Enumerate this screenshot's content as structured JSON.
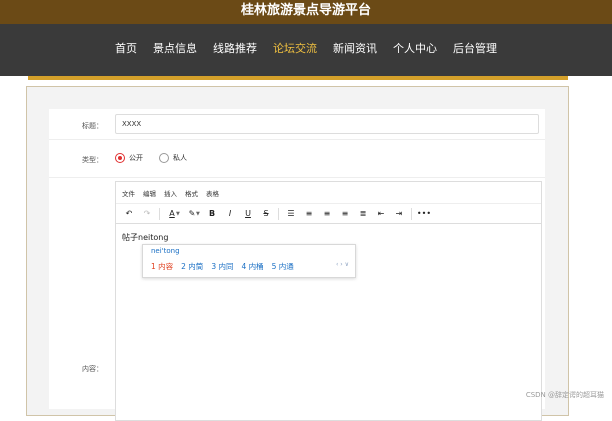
{
  "site": {
    "title": "桂林旅游景点导游平台"
  },
  "nav": {
    "items": [
      {
        "label": "首页"
      },
      {
        "label": "景点信息"
      },
      {
        "label": "线路推荐"
      },
      {
        "label": "论坛交流"
      },
      {
        "label": "新闻资讯"
      },
      {
        "label": "个人中心"
      },
      {
        "label": "后台管理"
      }
    ],
    "active_index": 3
  },
  "form": {
    "title_label": "标题：",
    "title_value": "XXXX",
    "type_label": "类型：",
    "type_options": [
      {
        "label": "公开",
        "checked": true
      },
      {
        "label": "私人",
        "checked": false
      }
    ],
    "content_label": "内容："
  },
  "editor": {
    "menus": [
      "文件",
      "编辑",
      "插入",
      "格式",
      "表格"
    ],
    "toolbar_icons": [
      "undo-icon",
      "redo-icon",
      "font-color-icon",
      "highlight-icon",
      "bold-icon",
      "italic-icon",
      "underline-icon",
      "strikethrough-icon",
      "list-icon",
      "align-left-icon",
      "align-center-icon",
      "align-right-icon",
      "align-justify-icon",
      "outdent-icon",
      "indent-icon",
      "more-icon"
    ],
    "content_text": "帖子neitong"
  },
  "ime": {
    "pinyin": "nei'tong",
    "candidates": [
      "1 内容",
      "2 内筒",
      "3 内同",
      "4 内桶",
      "5 内通"
    ],
    "nav": "‹ › ∨"
  },
  "watermark": "CSDN @辞定谔的超耳猫",
  "colors": {
    "header_brown": "#6b4a16",
    "nav_dark": "#3a3a3a",
    "active_gold": "#f0c040",
    "accent_orange": "#d4a02a",
    "radio_red": "#e03030"
  }
}
